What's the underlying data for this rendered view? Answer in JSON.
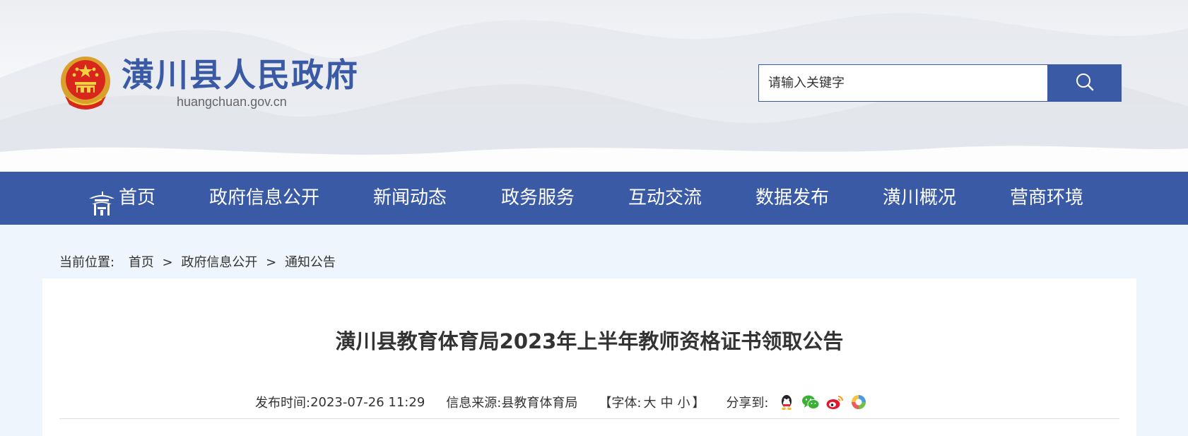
{
  "header": {
    "site_title": "潢川县人民政府",
    "site_domain": "huangchuan.gov.cn",
    "search": {
      "placeholder": "请输入关键字"
    }
  },
  "nav": {
    "items": [
      {
        "label": "首页",
        "icon": "home-pavilion-icon"
      },
      {
        "label": "政府信息公开"
      },
      {
        "label": "新闻动态"
      },
      {
        "label": "政务服务"
      },
      {
        "label": "互动交流"
      },
      {
        "label": "数据发布"
      },
      {
        "label": "潢川概况"
      },
      {
        "label": "营商环境"
      }
    ]
  },
  "breadcrumb": {
    "label": "当前位置:",
    "items": [
      "首页",
      "政府信息公开",
      "通知公告"
    ],
    "separator": ">"
  },
  "article": {
    "title": "潢川县教育体育局2023年上半年教师资格证书领取公告",
    "publish_label": "发布时间:",
    "publish_time": "2023-07-26 11:29",
    "source_label": "信息来源:",
    "source": "县教育体育局",
    "font_open": "【字体:",
    "font_sizes": [
      "大",
      "中",
      "小"
    ],
    "font_close": "】",
    "share_label": "分享到:",
    "share_icons": [
      "qq-icon",
      "wechat-icon",
      "weibo-icon",
      "qzone-icon"
    ]
  },
  "colors": {
    "brand": "#3a5aa6",
    "background": "#eef5fc"
  }
}
